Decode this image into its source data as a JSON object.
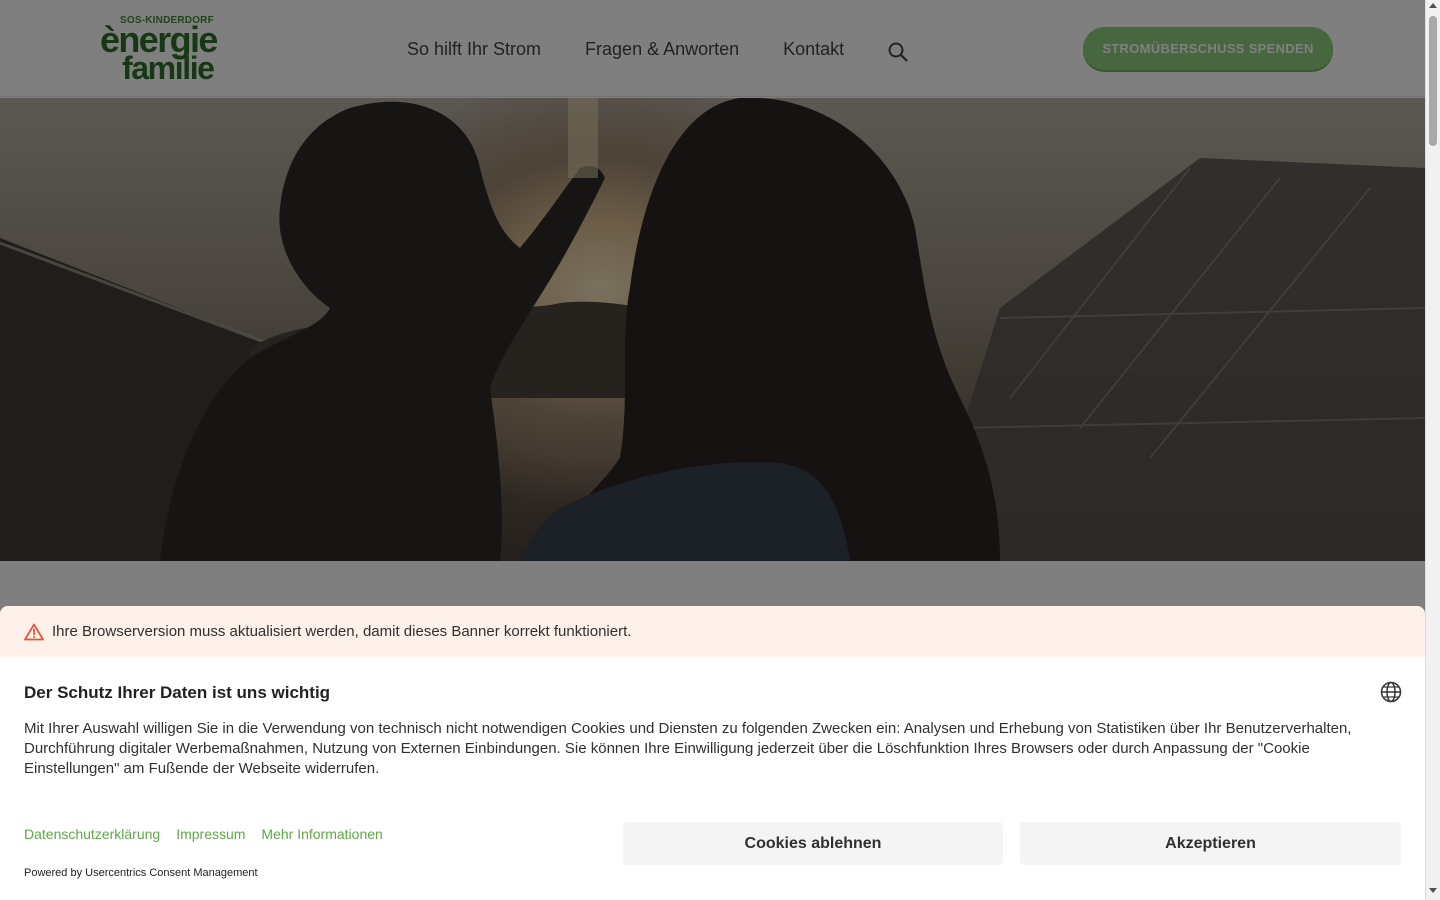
{
  "header": {
    "logo": {
      "top": "SOS-KINDERDORF",
      "line1": "ènergie",
      "line2": "familie"
    },
    "nav": [
      {
        "label": "So hilft Ihr Strom"
      },
      {
        "label": "Fragen & Anworten"
      },
      {
        "label": "Kontakt"
      }
    ],
    "search_icon": "search-icon",
    "cta_label": "STROMÜBERSCHUSS SPENDEN"
  },
  "colors": {
    "brand_green": "#2f6f2a",
    "cta_green": "#8fce7c",
    "link_green": "#5fa84a",
    "warning_bg": "#fdf1ea",
    "warning_icon": "#e2573b"
  },
  "consent": {
    "warning": "Ihre Browserversion muss aktualisiert werden, damit dieses Banner korrekt funktioniert.",
    "title": "Der Schutz Ihrer Daten ist uns wichtig",
    "body": "Mit Ihrer Auswahl willigen Sie in die Verwendung von technisch nicht notwendigen Cookies und Diensten zu folgenden Zwecken ein: Analysen und Erhebung von Statistiken über Ihr Benutzerverhalten, Durchführung digitaler Werbemaßnahmen, Nutzung von Externen Einbindungen. Sie können Ihre Einwilligung jederzeit über die Löschfunktion Ihres Browsers oder durch Anpassung der \"Cookie Einstellungen\" am Fußende der Webseite widerrufen.",
    "links": [
      {
        "label": "Datenschutzerklärung"
      },
      {
        "label": "Impressum"
      },
      {
        "label": "Mehr Informationen"
      }
    ],
    "decline_label": "Cookies ablehnen",
    "accept_label": "Akzeptieren",
    "powered_by": "Powered by Usercentrics Consent Management",
    "language_icon": "globe-icon"
  }
}
